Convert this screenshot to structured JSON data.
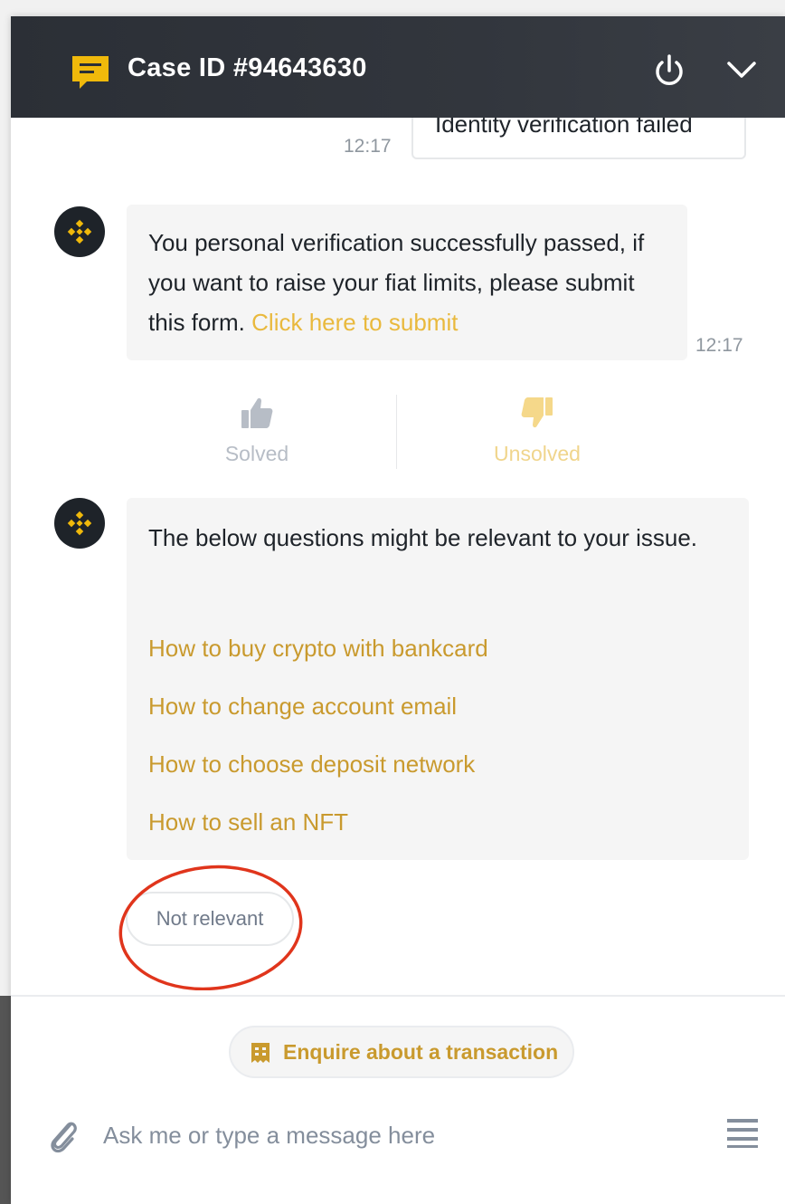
{
  "header": {
    "title": "Case ID #94643630",
    "case_icon": "chat-bubble-icon",
    "power_icon": "power-icon",
    "collapse_icon": "chevron-down-icon"
  },
  "messages": {
    "user_message": {
      "text": "Identity verification failed",
      "time": "12:17"
    },
    "verification_message": {
      "text": "You personal verification successfully passed, if you want to raise your fiat limits, please submit this form. ",
      "link": "Click here to submit",
      "time": "12:17"
    },
    "feedback": {
      "solved_label": "Solved",
      "unsolved_label": "Unsolved"
    },
    "suggestions": {
      "intro": "The below questions might be relevant to your issue.",
      "questions": [
        "How to buy crypto with bankcard",
        "How to change account email",
        "How to choose deposit network",
        "How to sell an NFT"
      ]
    },
    "not_relevant_label": "Not relevant"
  },
  "footer": {
    "enquire_label": "Enquire about a transaction",
    "input_placeholder": "Ask me or type a message here"
  },
  "colors": {
    "header_bg": "#2b2f36",
    "brand_yellow": "#f0b90b",
    "link_gold": "#c99a2e",
    "annotation_red": "#e0351c"
  }
}
